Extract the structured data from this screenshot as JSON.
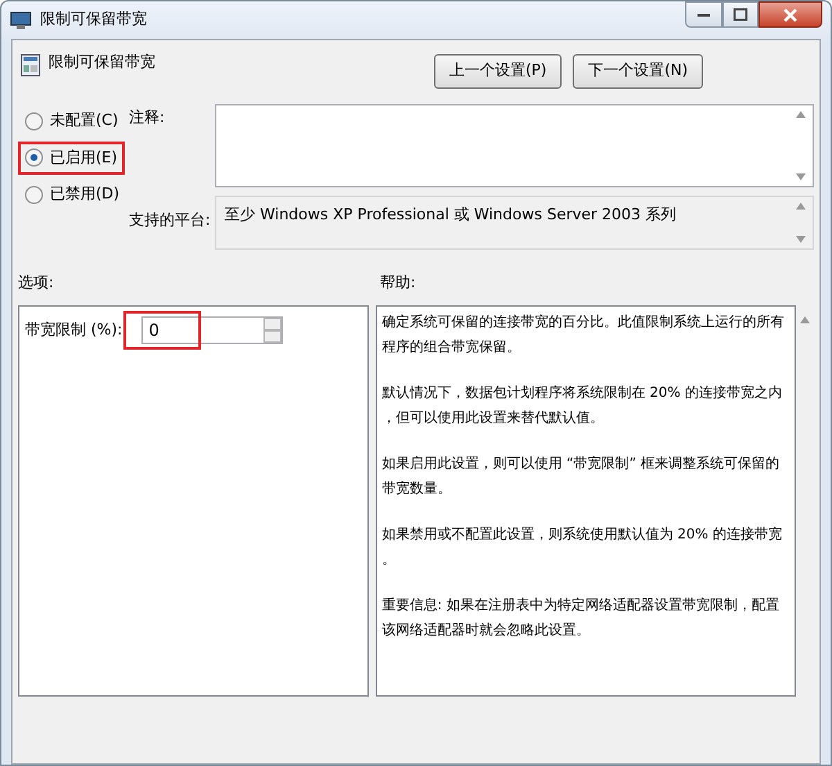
{
  "window": {
    "title": "限制可保留带宽"
  },
  "header": {
    "title": "限制可保留带宽"
  },
  "nav_buttons": [
    {
      "label": "上一个设置(P)"
    },
    {
      "label": "下一个设置(N)"
    }
  ],
  "state_options": [
    {
      "label": "未配置(C)",
      "selected": false,
      "highlighted": false
    },
    {
      "label": "已启用(E)",
      "selected": true,
      "highlighted": true
    },
    {
      "label": "已禁用(D)",
      "selected": false,
      "highlighted": false
    }
  ],
  "comment": {
    "label": "注释:"
  },
  "platform": {
    "label": "支持的平台:",
    "value": "至少 Windows XP Professional 或 Windows Server 2003 系列"
  },
  "options": {
    "label": "选项:",
    "field_label": "带宽限制 (%):",
    "value": "0",
    "highlighted": true
  },
  "help": {
    "label": "帮助:",
    "paragraphs": [
      [
        "确定系统可保留的连接带宽的百分比。此值限制系统上运行的所有",
        "程序的组合带宽保留。"
      ],
      [
        "默认情况下，数据包计划程序将系统限制在 20% 的连接带宽之内",
        "，但可以使用此设置来替代默认值。"
      ],
      [
        "如果启用此设置，则可以使用 “带宽限制” 框来调整系统可保留的",
        "带宽数量。"
      ],
      [
        "如果禁用或不配置此设置，则系统使用默认值为 20% 的连接带宽",
        "。"
      ],
      [
        "重要信息: 如果在注册表中为特定网络适配器设置带宽限制，配置",
        "该网络适配器时就会忽略此设置。"
      ]
    ]
  }
}
